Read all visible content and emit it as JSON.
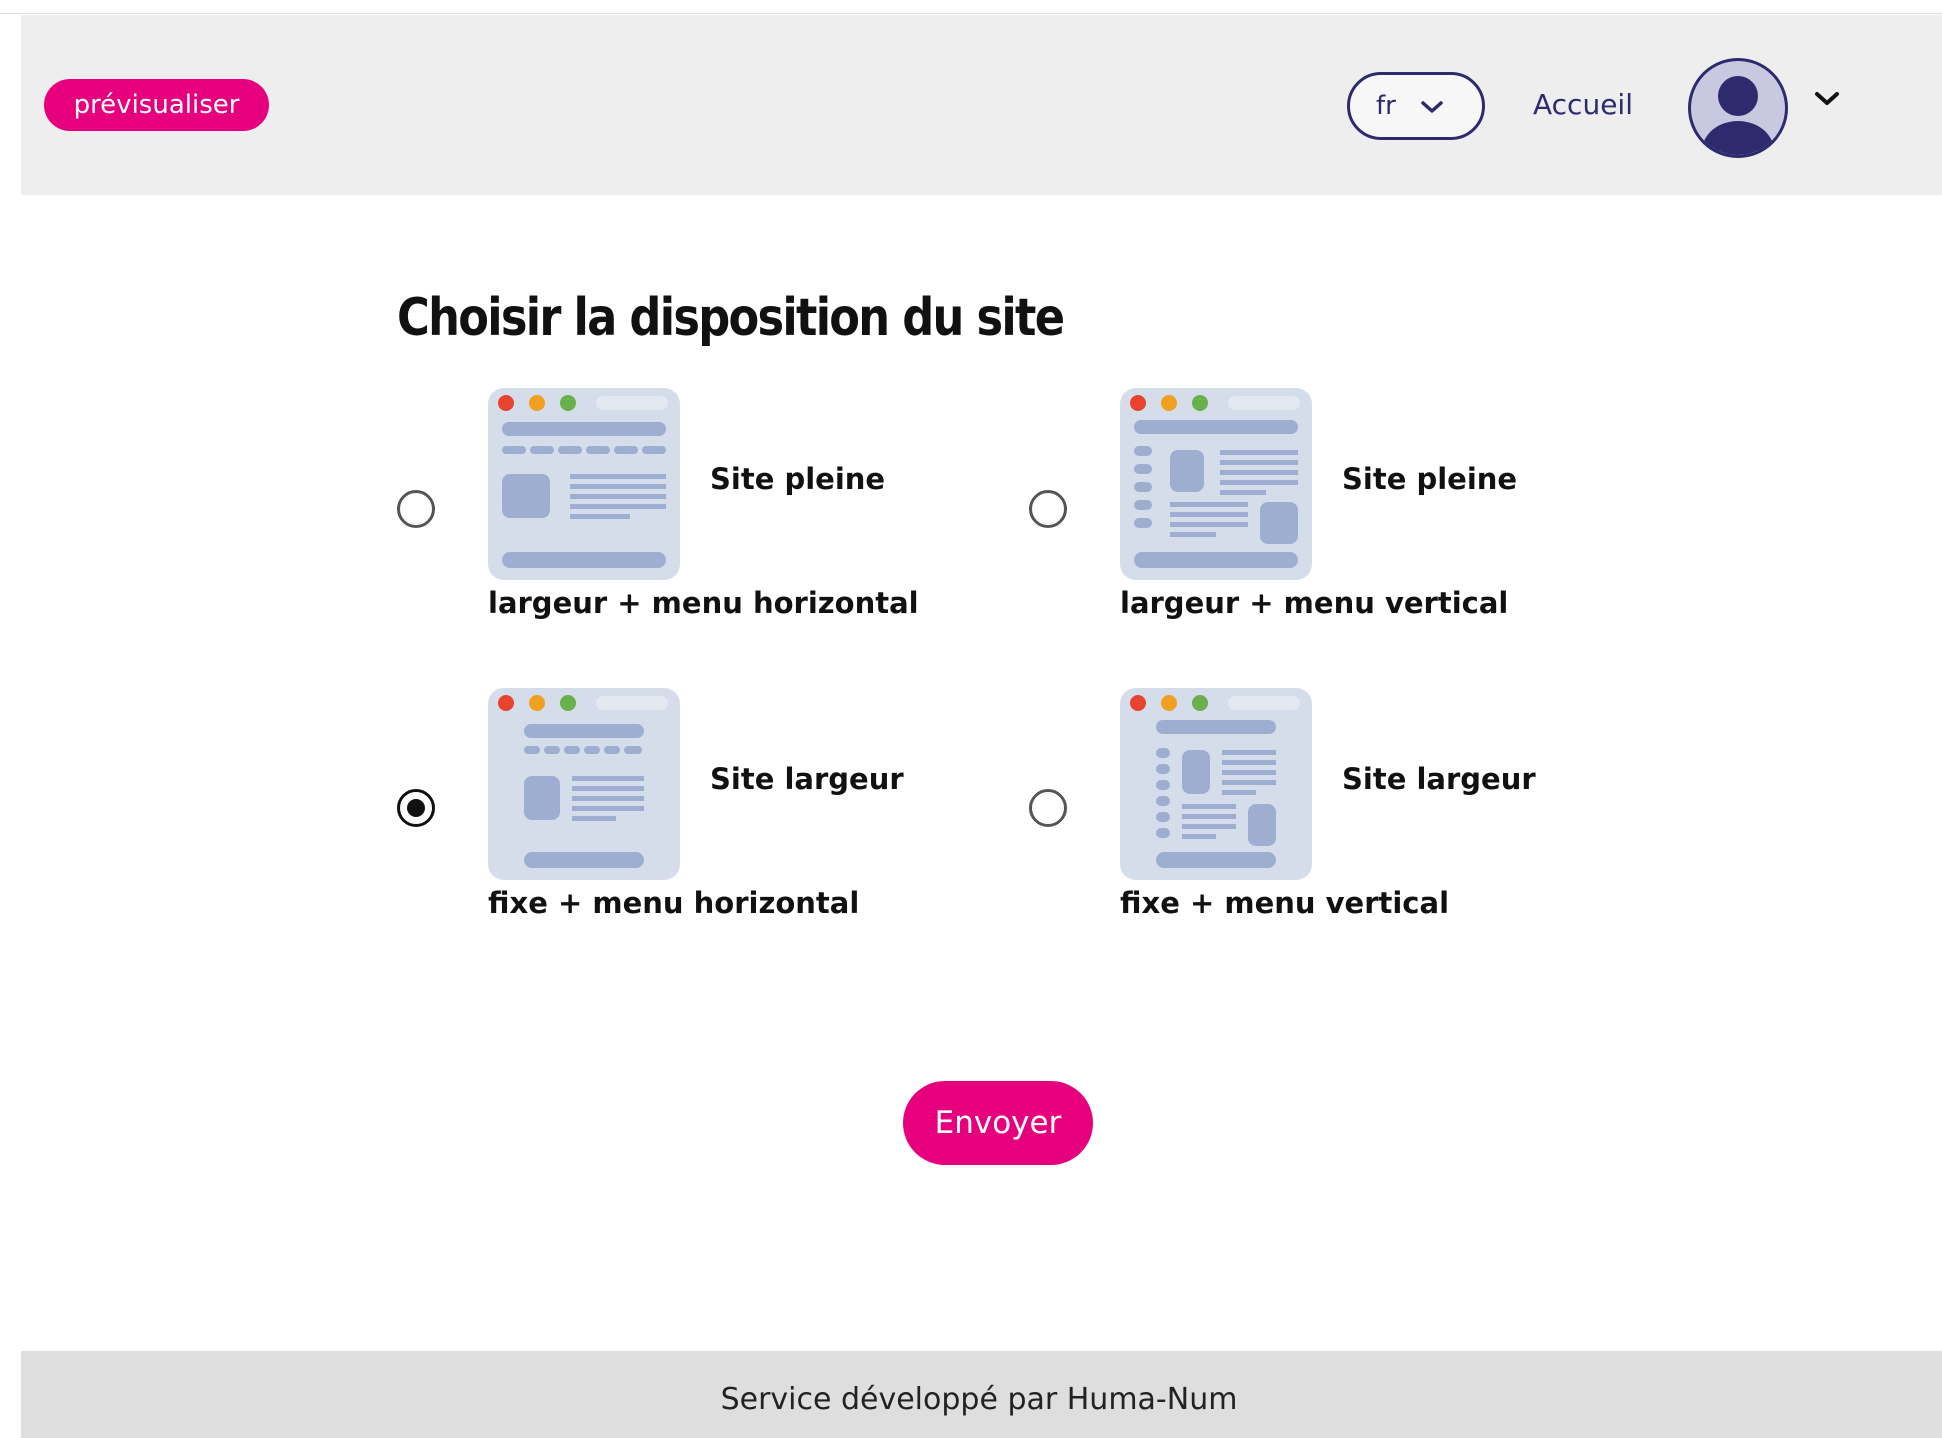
{
  "header": {
    "preview_label": "prévisualiser",
    "language": "fr",
    "home_link": "Accueil"
  },
  "page": {
    "title": "Choisir la disposition du site"
  },
  "layout_options": [
    {
      "line1": "Site pleine",
      "line2": "largeur + menu horizontal",
      "selected": false,
      "menu": "horizontal",
      "width": "full"
    },
    {
      "line1": "Site pleine",
      "line2": "largeur + menu vertical",
      "selected": false,
      "menu": "vertical",
      "width": "full"
    },
    {
      "line1": "Site largeur",
      "line2": "fixe + menu horizontal",
      "selected": true,
      "menu": "horizontal",
      "width": "fixed"
    },
    {
      "line1": "Site largeur",
      "line2": "fixe + menu vertical",
      "selected": false,
      "menu": "vertical",
      "width": "fixed"
    }
  ],
  "form": {
    "submit_label": "Envoyer"
  },
  "footer": {
    "text": "Service développé par Huma-Num"
  },
  "colors": {
    "accent": "#e6007e",
    "brand_dark": "#2d2a6e",
    "thumb_bg": "#d5dcea",
    "thumb_block": "#9eaed1"
  }
}
